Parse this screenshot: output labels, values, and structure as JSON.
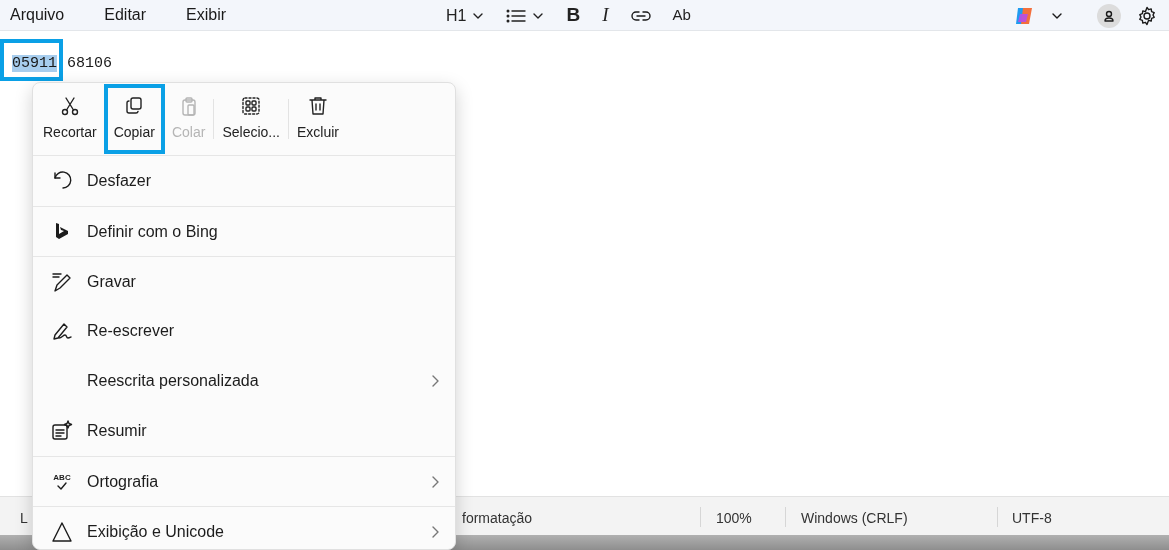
{
  "menubar": {
    "items": [
      "Arquivo",
      "Editar",
      "Exibir"
    ]
  },
  "toolbar": {
    "heading": "H1",
    "bold": "B",
    "italic": "I",
    "spell": "Ab"
  },
  "document": {
    "selected_text": "05911",
    "rest_text": "68106",
    "annotated": true
  },
  "context_menu": {
    "actions": [
      {
        "label": "Recortar",
        "kind": "cut",
        "disabled": false,
        "annotated": false
      },
      {
        "label": "Copiar",
        "kind": "copy",
        "disabled": false,
        "annotated": true
      },
      {
        "label": "Colar",
        "kind": "paste",
        "disabled": true,
        "annotated": false
      },
      {
        "label": "Selecio...",
        "kind": "select",
        "disabled": false,
        "annotated": false
      },
      {
        "label": "Excluir",
        "kind": "delete",
        "disabled": false,
        "annotated": false
      }
    ],
    "items": [
      {
        "label": "Desfazer",
        "kind": "undo",
        "divider_before": false,
        "submenu": false
      },
      {
        "label": "Definir com o Bing",
        "kind": "bing",
        "divider_before": true,
        "submenu": false
      },
      {
        "label": "Gravar",
        "kind": "pen",
        "divider_before": true,
        "submenu": false
      },
      {
        "label": "Re-escrever",
        "kind": "signature",
        "divider_before": false,
        "submenu": false
      },
      {
        "label": "Reescrita personalizada",
        "kind": "plain",
        "divider_before": false,
        "submenu": true
      },
      {
        "label": "Resumir",
        "kind": "summary",
        "divider_before": false,
        "submenu": false
      },
      {
        "label": "Ortografia",
        "kind": "spelling",
        "icon_text": "ABC",
        "divider_before": true,
        "submenu": true
      },
      {
        "label": "Exibição e Unicode",
        "kind": "warning",
        "divider_before": true,
        "submenu": true
      }
    ]
  },
  "status_bar": {
    "items": [
      "L",
      "formatação",
      "100%",
      "Windows (CRLF)",
      "UTF-8"
    ]
  }
}
